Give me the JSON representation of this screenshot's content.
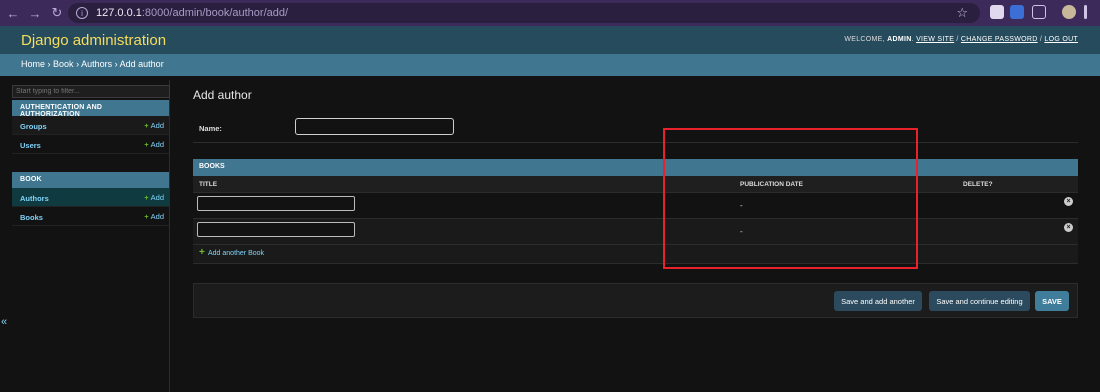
{
  "browser": {
    "url_host": "127.0.0.1",
    "url_path": ":8000/admin/book/author/add/"
  },
  "header": {
    "brand": "Django administration",
    "welcome": "WELCOME,",
    "username": "ADMIN",
    "view_site": "VIEW SITE",
    "change_password": "CHANGE PASSWORD",
    "log_out": "LOG OUT",
    "separator": "/"
  },
  "breadcrumbs": {
    "items": [
      "Home",
      "Book",
      "Authors",
      "Add author"
    ],
    "separator": "›"
  },
  "sidebar": {
    "filter_placeholder": "Start typing to filter...",
    "modules": [
      {
        "caption": "AUTHENTICATION AND AUTHORIZATION",
        "models": [
          {
            "name": "Groups",
            "add": "Add"
          },
          {
            "name": "Users",
            "add": "Add"
          }
        ]
      },
      {
        "caption": "BOOK",
        "models": [
          {
            "name": "Authors",
            "add": "Add"
          },
          {
            "name": "Books",
            "add": "Add"
          }
        ]
      }
    ],
    "collapse_icon": "«"
  },
  "main": {
    "title": "Add author",
    "name_label": "Name:",
    "name_value": "",
    "inline": {
      "caption": "BOOKS",
      "columns": [
        "TITLE",
        "PUBLICATION DATE",
        "DELETE?"
      ],
      "rows": [
        {
          "title": "",
          "publication_date": "-"
        },
        {
          "title": "",
          "publication_date": "-"
        }
      ],
      "add_another": "Add another Book"
    },
    "buttons": {
      "save_add_another": "Save and add another",
      "save_continue": "Save and continue editing",
      "save": "SAVE"
    }
  },
  "colors": {
    "header_bg": "#264b5d",
    "brand": "#f5dd5d",
    "breadcrumb_bg": "#417690",
    "link": "#81d4fa",
    "add_plus": "#70bf2b",
    "highlight": "#e8222b"
  }
}
